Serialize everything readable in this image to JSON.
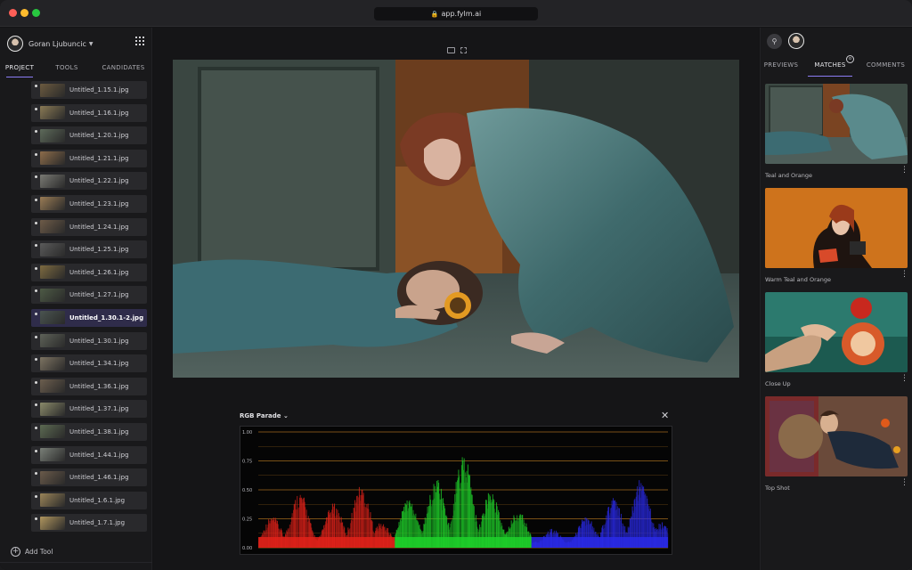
{
  "browser": {
    "url": "app.fylm.ai"
  },
  "left_panel": {
    "user_name": "Goran Ljubuncic",
    "tabs": [
      {
        "label": "PROJECT",
        "active": true
      },
      {
        "label": "TOOLS",
        "active": false
      },
      {
        "label": "CANDIDATES",
        "active": false
      }
    ],
    "files": [
      {
        "name": "Untitled_1.15.1.jpg",
        "thumb": "#6b5a3f"
      },
      {
        "name": "Untitled_1.16.1.jpg",
        "thumb": "#8a7a55"
      },
      {
        "name": "Untitled_1.20.1.jpg",
        "thumb": "#5d6a5a"
      },
      {
        "name": "Untitled_1.21.1.jpg",
        "thumb": "#8d6c4a"
      },
      {
        "name": "Untitled_1.22.1.jpg",
        "thumb": "#7a7a74"
      },
      {
        "name": "Untitled_1.23.1.jpg",
        "thumb": "#9a7c55"
      },
      {
        "name": "Untitled_1.24.1.jpg",
        "thumb": "#6e5b48"
      },
      {
        "name": "Untitled_1.25.1.jpg",
        "thumb": "#5a5a5a"
      },
      {
        "name": "Untitled_1.26.1.jpg",
        "thumb": "#7d6a40"
      },
      {
        "name": "Untitled_1.27.1.jpg",
        "thumb": "#4d5a45"
      },
      {
        "name": "Untitled_1.30.1-2.jpg",
        "thumb": "#4a5450",
        "active": true
      },
      {
        "name": "Untitled_1.30.1.jpg",
        "thumb": "#5e6258"
      },
      {
        "name": "Untitled_1.34.1.jpg",
        "thumb": "#7e7462"
      },
      {
        "name": "Untitled_1.36.1.jpg",
        "thumb": "#6c5e4e"
      },
      {
        "name": "Untitled_1.37.1.jpg",
        "thumb": "#8a8a6a"
      },
      {
        "name": "Untitled_1.38.1.jpg",
        "thumb": "#5c6a52"
      },
      {
        "name": "Untitled_1.44.1.jpg",
        "thumb": "#7a8078"
      },
      {
        "name": "Untitled_1.46.1.jpg",
        "thumb": "#6a5a4a"
      },
      {
        "name": "Untitled_1.6.1.jpg",
        "thumb": "#9a8458"
      },
      {
        "name": "Untitled_1.7.1.jpg",
        "thumb": "#b0965e"
      }
    ],
    "add_tool_label": "Add Tool"
  },
  "center": {
    "scope_title": "RGB Parade",
    "scope_close": "✕",
    "scope_ticks": [
      "1.00",
      "0.75",
      "0.50",
      "0.25",
      "0.00"
    ],
    "scope_channels": [
      "red",
      "green",
      "blue"
    ],
    "colors": {
      "scope_grid": "#a06a1c",
      "red": "#e0221a",
      "green": "#1fd12a",
      "blue": "#2a2ae8"
    }
  },
  "right_panel": {
    "tabs": [
      {
        "label": "PREVIEWS",
        "active": false
      },
      {
        "label": "MATCHES",
        "active": true
      },
      {
        "label": "COMMENTS",
        "active": false
      }
    ],
    "matches_badge": "o",
    "matches": [
      {
        "label": "Teal and Orange",
        "more": "⋮"
      },
      {
        "label": "Warm Teal and Orange",
        "more": "⋮"
      },
      {
        "label": "Close Up",
        "more": "⋮"
      },
      {
        "label": "Top Shot",
        "more": "⋮"
      }
    ]
  },
  "icons": {
    "user_avatar": "avatar",
    "apps_grid": "grid-icon",
    "add_user": "add-user-icon",
    "lock": "lock-icon",
    "close": "close-icon",
    "add": "plus-circle-icon"
  }
}
